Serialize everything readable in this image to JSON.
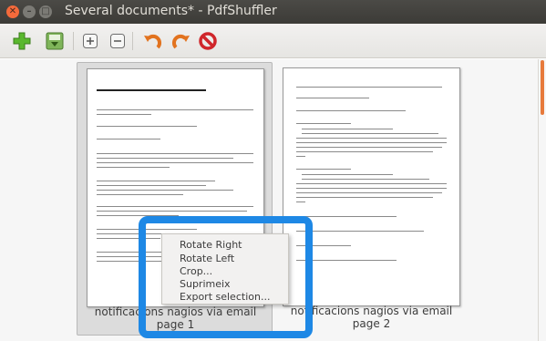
{
  "window": {
    "title": "Several documents* - PdfShuffler",
    "close_glyph": "✕",
    "min_glyph": "–",
    "max_glyph": "□"
  },
  "toolbar": {
    "buttons": [
      {
        "name": "add-document-button",
        "icon": "plus-icon"
      },
      {
        "name": "export-button",
        "icon": "save-download-icon"
      },
      {
        "name": "zoom-in-button",
        "icon": "zoom-in-icon"
      },
      {
        "name": "zoom-out-button",
        "icon": "zoom-out-icon"
      },
      {
        "name": "rotate-left-button",
        "icon": "rotate-counterclockwise-icon"
      },
      {
        "name": "rotate-right-button",
        "icon": "rotate-clockwise-icon"
      },
      {
        "name": "delete-button",
        "icon": "no-entry-icon"
      }
    ]
  },
  "pages": [
    {
      "caption_line1": "notificacions nagios via email",
      "caption_line2": "page 1",
      "selected": true
    },
    {
      "caption_line1": "notificacions nagios via email",
      "caption_line2": "page 2",
      "selected": false
    }
  ],
  "context_menu": {
    "items": [
      {
        "label": "Rotate Right"
      },
      {
        "label": "Rotate Left"
      },
      {
        "label": "Crop..."
      },
      {
        "label": "Suprimeix"
      },
      {
        "label": "Export selection..."
      }
    ]
  },
  "colors": {
    "titlebar": "#3c3b37",
    "close_button": "#f46a3b",
    "highlight": "#1e88e5",
    "scroll_accent": "#e77a3b"
  }
}
